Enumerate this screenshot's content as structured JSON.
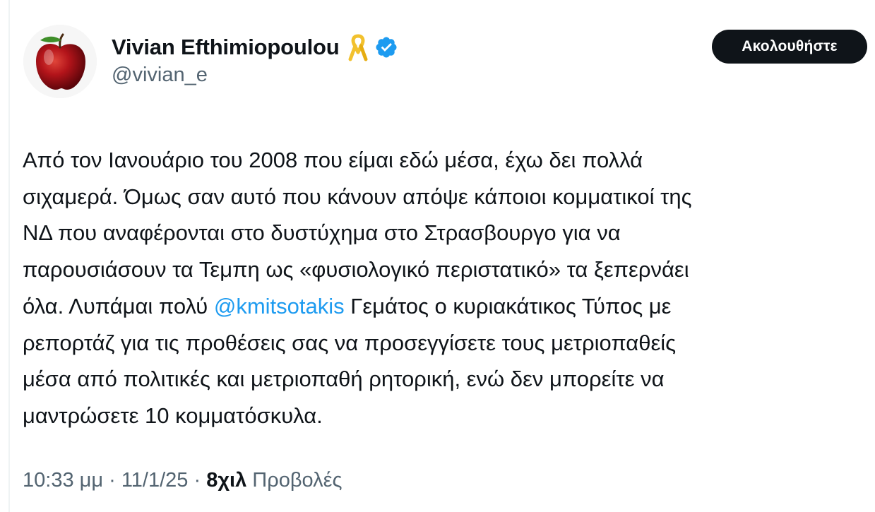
{
  "author": {
    "display_name": "Vivian Efthimiopoulou",
    "handle": "@vivian_e",
    "avatar_icon": "red-apple-icon",
    "badge_icons": [
      "yellow-ribbon-icon",
      "verified-badge-icon"
    ],
    "verified_color": "#1d9bf0"
  },
  "follow_button": {
    "label": "Ακολουθήστε"
  },
  "tweet": {
    "line1": "Από τον Ιανουάριο του 2008 που είμαι εδώ μέσα, έχω δει πολλά",
    "line2": "σιχαμερά. Όμως σαν αυτό που κάνουν απόψε κάποιοι κομματικοί της",
    "line3": "ΝΔ που αναφέρονται στο δυστύχημα στο Στρασβουργο για να",
    "line4": "παρουσιάσουν τα Τεμπη ως «φυσιολογικό περιστατικό»  τα ξεπερνάει",
    "line5_before": "όλα. Λυπάμαι πολύ ",
    "mention": "@kmitsotakis",
    "line5_after": " Γεμάτος ο κυριακάτικος Τύπος με",
    "line6": "ρεπορτάζ για τις προθέσεις σας να προσεγγίσετε τους μετριοπαθείς",
    "line7": "μέσα από πολιτικές και μετριοπαθή ρητορική, ενώ δεν μπορείτε να",
    "line8": "μαντρώσετε 10 κομματόσκυλα."
  },
  "meta": {
    "time": "10:33 μμ",
    "separator": " · ",
    "date": "11/1/25",
    "views_count": "8χιλ",
    "views_label": " Προβολές"
  },
  "colors": {
    "text": "#0f1419",
    "secondary": "#536471",
    "link": "#1d9bf0",
    "button_bg": "#0f1419"
  }
}
